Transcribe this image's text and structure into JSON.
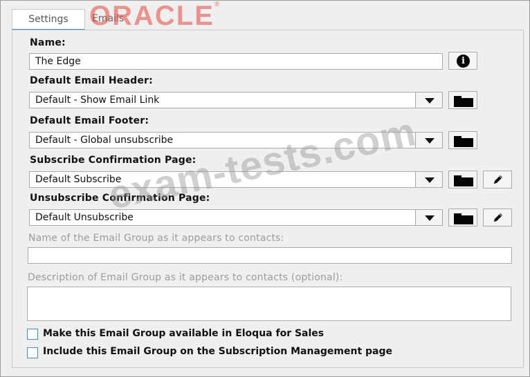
{
  "tabs": [
    {
      "label": "Settings",
      "active": true
    },
    {
      "label": "Emails",
      "active": false
    }
  ],
  "form": {
    "name_label": "Name:",
    "name_value": "The Edge",
    "header_label": "Default Email Header:",
    "header_value": "Default - Show Email Link",
    "footer_label": "Default Email Footer:",
    "footer_value": "Default - Global unsubscribe",
    "subscribe_label": "Subscribe Confirmation Page:",
    "subscribe_value": "Default Subscribe",
    "unsubscribe_label": "Unsubscribe Confirmation Page:",
    "unsubscribe_value": "Default Unsubscribe",
    "display_name_label": "Name of the Email Group as it appears to contacts:",
    "display_name_value": "",
    "description_label": "Description of Email Group as it appears to contacts (optional):",
    "description_value": "",
    "sales_checkbox_label": "Make this Email Group available in Eloqua for Sales",
    "sales_checked": false,
    "subscription_checkbox_label": "Include this Email Group on the Subscription Management page",
    "subscription_checked": false
  },
  "watermarks": {
    "logo": "ORACLE",
    "logo_mark": "®",
    "site": "exam-tests.com"
  },
  "colors": {
    "accent": "#3a8fc7",
    "panel_bg": "#efefef",
    "logo_red": "#e6463c"
  }
}
